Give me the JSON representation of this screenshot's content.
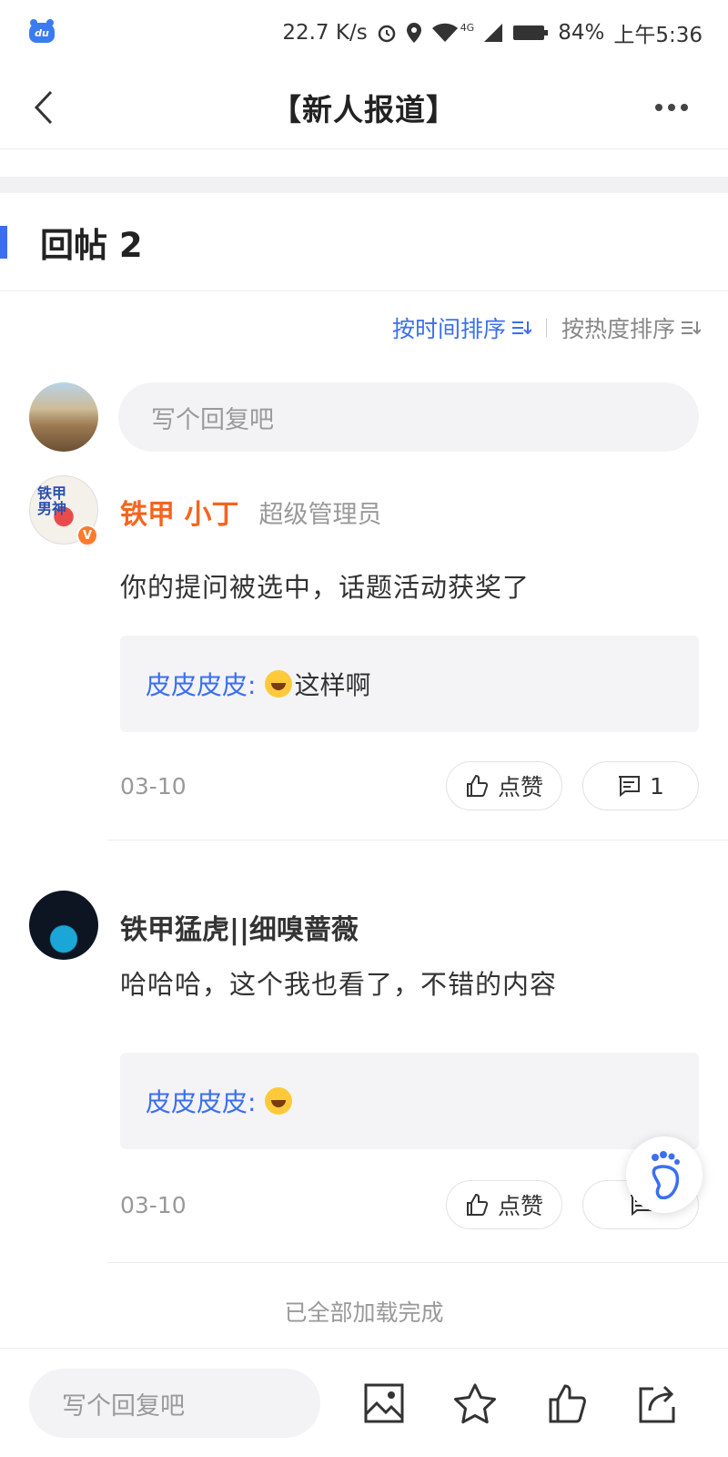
{
  "status_bar": {
    "app_badge": "du",
    "speed": "22.7 K/s",
    "network": "4G",
    "battery": "84%",
    "time": "上午5:36"
  },
  "nav": {
    "title": "【新人报道】"
  },
  "replies": {
    "title": "回帖 2"
  },
  "sort": {
    "by_time": "按时间排序",
    "by_heat": "按热度排序"
  },
  "compose": {
    "placeholder": "写个回复吧"
  },
  "comments": [
    {
      "username": "铁甲 小丁",
      "role": "超级管理员",
      "avatar_text": "铁甲\n男神",
      "vip_badge": "V",
      "text": "你的提问被选中，话题活动获奖了",
      "quote_user": "皮皮皮皮:",
      "quote_text": "这样啊",
      "date": "03-10",
      "like_label": "点赞",
      "reply_count": "1"
    },
    {
      "username": "铁甲猛虎||细嗅蔷薇",
      "text": "哈哈哈，这个我也看了，不错的内容",
      "quote_user": "皮皮皮皮:",
      "quote_text": "",
      "date": "03-10",
      "like_label": "点赞"
    }
  ],
  "footer": {
    "load_complete": "已全部加载完成"
  },
  "bottom_bar": {
    "placeholder": "写个回复吧"
  },
  "colors": {
    "accent": "#3b6ff0",
    "vip_name": "#f5641e"
  }
}
